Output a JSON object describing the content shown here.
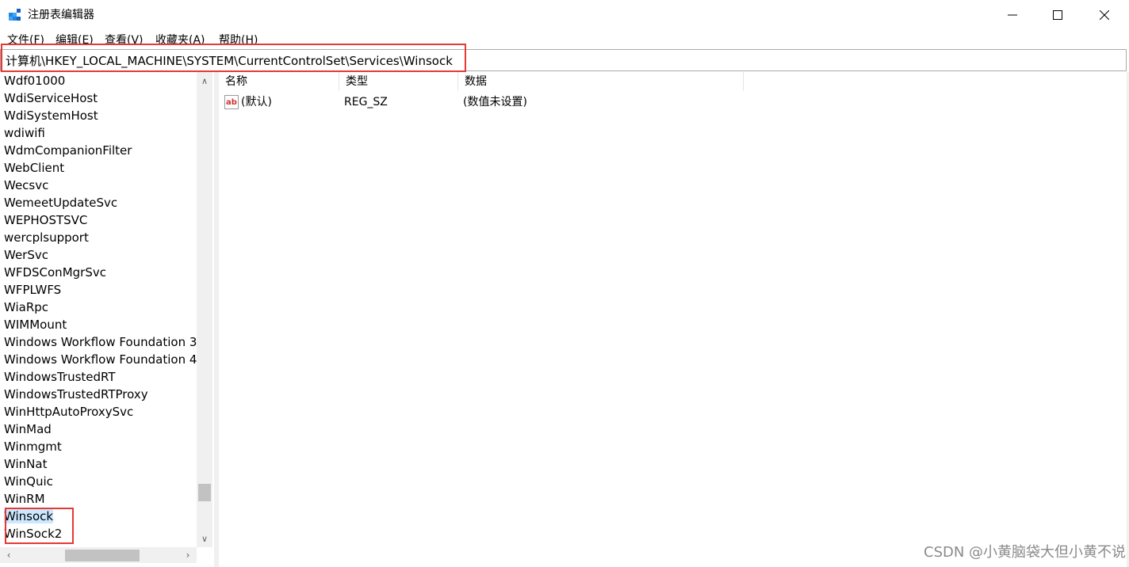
{
  "window": {
    "title": "注册表编辑器",
    "controls": {
      "minimize": "minimize-icon",
      "maximize": "maximize-icon",
      "close": "close-icon"
    }
  },
  "menu": [
    {
      "label": "文件(F)"
    },
    {
      "label": "编辑(E)"
    },
    {
      "label": "查看(V)"
    },
    {
      "label": "收藏夹(A)"
    },
    {
      "label": "帮助(H)"
    }
  ],
  "address": {
    "path": "计算机\\HKEY_LOCAL_MACHINE\\SYSTEM\\CurrentControlSet\\Services\\Winsock"
  },
  "tree": {
    "items": [
      "Wdf01000",
      "WdiServiceHost",
      "WdiSystemHost",
      "wdiwifi",
      "WdmCompanionFilter",
      "WebClient",
      "Wecsvc",
      "WemeetUpdateSvc",
      "WEPHOSTSVC",
      "wercplsupport",
      "WerSvc",
      "WFDSConMgrSvc",
      "WFPLWFS",
      "WiaRpc",
      "WIMMount",
      "Windows Workflow Foundation 3.",
      "Windows Workflow Foundation 4.",
      "WindowsTrustedRT",
      "WindowsTrustedRTProxy",
      "WinHttpAutoProxySvc",
      "WinMad",
      "Winmgmt",
      "WinNat",
      "WinQuic",
      "WinRM",
      "Winsock",
      "WinSock2"
    ],
    "selected": "Winsock"
  },
  "columns": {
    "name": "名称",
    "type": "类型",
    "data": "数据"
  },
  "values": [
    {
      "name": "(默认)",
      "type": "REG_SZ",
      "data": "(数值未设置)"
    }
  ],
  "watermark": "CSDN @小黄脑袋大但小黄不说",
  "colors": {
    "highlight": "#e53935",
    "selection": "#cce8ff"
  }
}
